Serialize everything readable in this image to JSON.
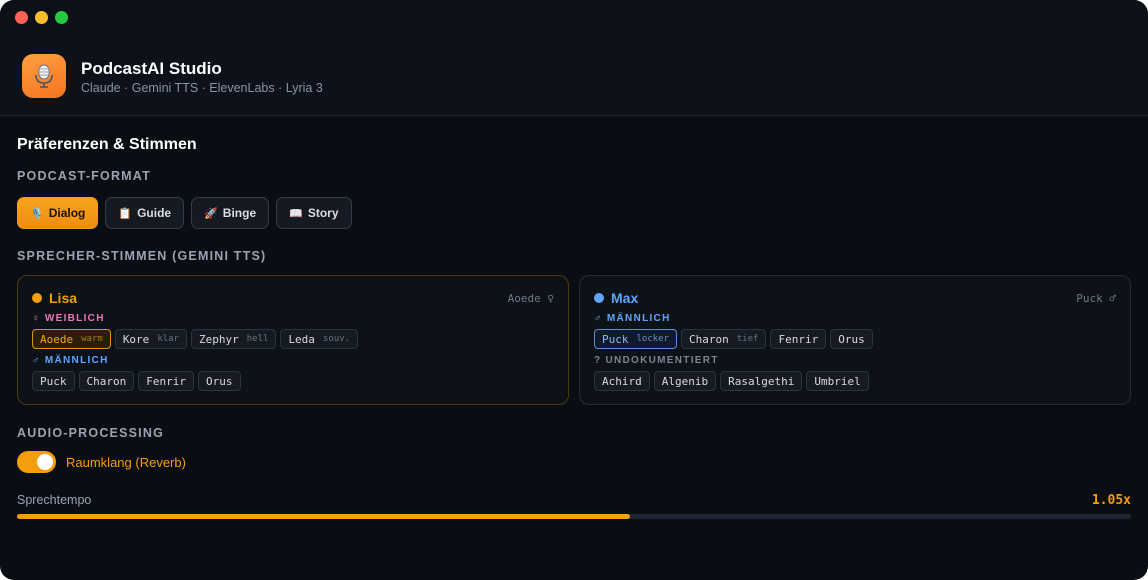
{
  "window": {
    "controls": [
      "close",
      "minimize",
      "maximize"
    ]
  },
  "app": {
    "icon": "microphone-icon",
    "title": "PodcastAI Studio",
    "subtitle": "Claude · Gemini TTS · ElevenLabs · Lyria 3",
    "accent": "#f59e0b"
  },
  "preferences": {
    "title": "Präferenzen & Stimmen",
    "format_label": "PODCAST-FORMAT",
    "formats": [
      {
        "emoji": "🎙️",
        "label": "Dialog",
        "active": true
      },
      {
        "emoji": "📋",
        "label": "Guide",
        "active": false
      },
      {
        "emoji": "🚀",
        "label": "Binge",
        "active": false
      },
      {
        "emoji": "📖",
        "label": "Story",
        "active": false
      }
    ],
    "voices_label": "SPRECHER-STIMMEN (GEMINI TTS)"
  },
  "speakers": {
    "lisa": {
      "name": "Lisa",
      "color": "#f59e0b",
      "voice": "Aoede ♀",
      "group1_label": "♀ WEIBLICH",
      "group1_color": "#e879b9",
      "group1": [
        {
          "name": "Aoede",
          "desc": "warm",
          "selected": true
        },
        {
          "name": "Kore",
          "desc": "klar"
        },
        {
          "name": "Zephyr",
          "desc": "hell"
        },
        {
          "name": "Leda",
          "desc": "souv."
        }
      ],
      "group2_label": "♂ MÄNNLICH",
      "group2_color": "#60a5fa",
      "group2": [
        {
          "name": "Puck"
        },
        {
          "name": "Charon"
        },
        {
          "name": "Fenrir"
        },
        {
          "name": "Orus"
        }
      ]
    },
    "max": {
      "name": "Max",
      "color": "#60a5fa",
      "voice": "Puck ♂",
      "group1_label": "♂ MÄNNLICH",
      "group1_color": "#60a5fa",
      "group1": [
        {
          "name": "Puck",
          "desc": "locker",
          "selected": true
        },
        {
          "name": "Charon",
          "desc": "tief"
        },
        {
          "name": "Fenrir"
        },
        {
          "name": "Orus"
        }
      ],
      "group2_label": "? UNDOKUMENTIERT",
      "group2_color": "#7b8494",
      "group2": [
        {
          "name": "Achird"
        },
        {
          "name": "Algenib"
        },
        {
          "name": "Rasalgethi"
        },
        {
          "name": "Umbriel"
        }
      ]
    }
  },
  "audio": {
    "label": "AUDIO-PROCESSING",
    "reverb_label": "Raumklang (Reverb)",
    "reverb_on": true,
    "tempo_label": "Sprechtempo",
    "tempo_value": "1.05x",
    "tempo_fraction": 0.55
  }
}
